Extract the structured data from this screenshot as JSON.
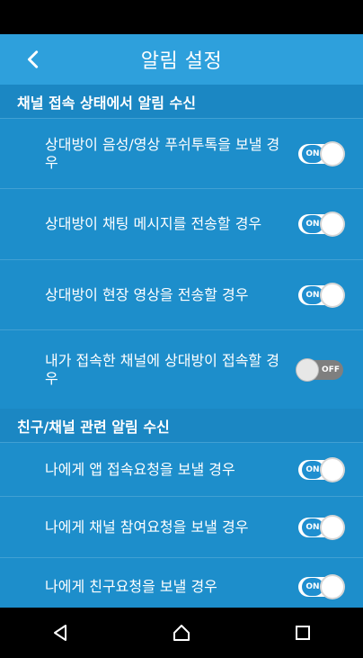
{
  "app_bar": {
    "title": "알림 설정",
    "back_icon": "chevron-left"
  },
  "sections": [
    {
      "header": "채널 접속 상태에서 알림 수신",
      "items": [
        {
          "label": "상대방이 음성/영상 푸쉬투톡을 보낼 경우",
          "state": "ON",
          "enabled": true
        },
        {
          "label": "상대방이 채팅 메시지를 전송할 경우",
          "state": "ON",
          "enabled": true
        },
        {
          "label": "상대방이 현장 영상을 전송할 경우",
          "state": "ON",
          "enabled": true
        },
        {
          "label": "내가 접속한 채널에 상대방이 접속할 경우",
          "state": "OFF",
          "enabled": false
        }
      ]
    },
    {
      "header": "친구/채널 관련 알림 수신",
      "items": [
        {
          "label": "나에게 앱 접속요청을 보낼 경우",
          "state": "ON",
          "enabled": true
        },
        {
          "label": "나에게 채널 참여요청을 보낼 경우",
          "state": "ON",
          "enabled": true
        },
        {
          "label": "나에게 친구요청을 보낼 경우",
          "state": "ON",
          "enabled": true
        }
      ]
    }
  ],
  "nav": {
    "back": "back-triangle",
    "home": "home",
    "recents": "recents-square"
  },
  "colors": {
    "background": "#1d8ecb",
    "app_bar": "#2ea0dc",
    "status_bar": "#000000"
  }
}
